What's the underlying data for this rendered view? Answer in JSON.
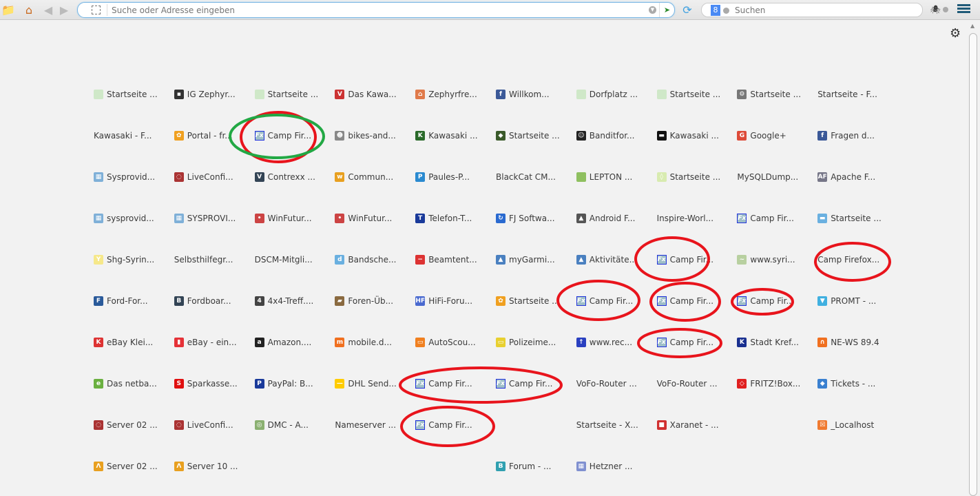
{
  "toolbar": {
    "address_placeholder": "Suche oder Adresse eingeben",
    "search_placeholder": "Suchen",
    "search_engine": "8"
  },
  "colors": {
    "annotation_red": "#e8141c",
    "annotation_green": "#22a844"
  },
  "grid": [
    [
      {
        "t": "Startseite ...",
        "i": "quill"
      },
      {
        "t": "IG Zephyr...",
        "i": "badge"
      },
      {
        "t": "Startseite ...",
        "i": "quill"
      },
      {
        "t": "Das Kawa...",
        "i": "v"
      },
      {
        "t": "Zephyrfre...",
        "i": "house"
      },
      {
        "t": "Willkom...",
        "i": "facebook"
      },
      {
        "t": "Dorfplatz ...",
        "i": "quill"
      },
      {
        "t": "Startseite ...",
        "i": "quill"
      },
      {
        "t": "Startseite ...",
        "i": "gear"
      },
      {
        "t": "Startseite - F...",
        "i": ""
      }
    ],
    [
      {
        "t": "Kawasaki - F...",
        "i": ""
      },
      {
        "t": "Portal - fr...",
        "i": "portal"
      },
      {
        "t": "Camp Fir...",
        "i": "fx"
      },
      {
        "t": "bikes-and...",
        "i": "skull"
      },
      {
        "t": "Kawasaki ...",
        "i": "kawasaki"
      },
      {
        "t": "Startseite ...",
        "i": "shield"
      },
      {
        "t": "Banditfor...",
        "i": "smiley"
      },
      {
        "t": "Kawasaki ...",
        "i": "kw"
      },
      {
        "t": "Google+",
        "i": "gplus"
      },
      {
        "t": "Fragen d...",
        "i": "facebook"
      }
    ],
    [
      {
        "t": "Sysprovid...",
        "i": "sys"
      },
      {
        "t": "LiveConfi...",
        "i": "live"
      },
      {
        "t": "Contrexx ...",
        "i": "contrexx"
      },
      {
        "t": "Commun...",
        "i": "comm"
      },
      {
        "t": "Paules-P...",
        "i": "paules"
      },
      {
        "t": "BlackCat CM...",
        "i": ""
      },
      {
        "t": "LEPTON ...",
        "i": "lepton"
      },
      {
        "t": "Startseite ...",
        "i": "bottle"
      },
      {
        "t": "MySQLDump...",
        "i": ""
      },
      {
        "t": "Apache F...",
        "i": "af"
      }
    ],
    [
      {
        "t": "sysprovid...",
        "i": "sys"
      },
      {
        "t": "SYSPROVI...",
        "i": "sys"
      },
      {
        "t": "WinFutur...",
        "i": "winf"
      },
      {
        "t": "WinFutur...",
        "i": "winf"
      },
      {
        "t": "Telefon-T...",
        "i": "tt"
      },
      {
        "t": "FJ Softwa...",
        "i": "fj"
      },
      {
        "t": "Android F...",
        "i": "android"
      },
      {
        "t": "Inspire-Worl...",
        "i": ""
      },
      {
        "t": "Camp Fir...",
        "i": "fx"
      },
      {
        "t": "Startseite ...",
        "i": "chat"
      }
    ],
    [
      {
        "t": "Shg-Syrin...",
        "i": "shg"
      },
      {
        "t": "Selbsthilfegr...",
        "i": ""
      },
      {
        "t": "DSCM-Mitgli...",
        "i": ""
      },
      {
        "t": "Bandsche...",
        "i": "db"
      },
      {
        "t": "Beamtent...",
        "i": "stop"
      },
      {
        "t": "myGarmi...",
        "i": "garmin"
      },
      {
        "t": "Aktivitäte...",
        "i": "garmin"
      },
      {
        "t": "Camp Fir...",
        "i": "fx"
      },
      {
        "t": "www.syri...",
        "i": "syri"
      },
      {
        "t": "Camp Firefox...",
        "i": ""
      }
    ],
    [
      {
        "t": "Ford-For...",
        "i": "ford"
      },
      {
        "t": "Fordboar...",
        "i": "fordboard"
      },
      {
        "t": "4x4-Treff....",
        "i": "4x4"
      },
      {
        "t": "Foren-Üb...",
        "i": "foren"
      },
      {
        "t": "HiFi-Foru...",
        "i": "hf"
      },
      {
        "t": "Startseite ...",
        "i": "portal"
      },
      {
        "t": "Camp Fir...",
        "i": "fx"
      },
      {
        "t": "Camp Fir...",
        "i": "fx"
      },
      {
        "t": "Camp Fir...",
        "i": "fx"
      },
      {
        "t": "PROMT - ...",
        "i": "promt"
      }
    ],
    [
      {
        "t": "eBay Klei...",
        "i": "k"
      },
      {
        "t": "eBay - ein...",
        "i": "ebay"
      },
      {
        "t": "Amazon....",
        "i": "amazon"
      },
      {
        "t": "mobile.d...",
        "i": "mobile"
      },
      {
        "t": "AutoScou...",
        "i": "auto"
      },
      {
        "t": "Polizeime...",
        "i": "note"
      },
      {
        "t": "www.rec...",
        "i": "fdr"
      },
      {
        "t": "Camp Fir...",
        "i": "fx"
      },
      {
        "t": "Stadt Kref...",
        "i": "kr"
      },
      {
        "t": "NE-WS 89.4",
        "i": "headphones"
      }
    ],
    [
      {
        "t": "Das netba...",
        "i": "netbank"
      },
      {
        "t": "Sparkasse...",
        "i": "sparkasse"
      },
      {
        "t": "PayPal: B...",
        "i": "paypal"
      },
      {
        "t": "DHL Send...",
        "i": "dhl"
      },
      {
        "t": "Camp Fir...",
        "i": "fx"
      },
      {
        "t": "Camp Fir...",
        "i": "fx"
      },
      {
        "t": "VoFo-Router ...",
        "i": ""
      },
      {
        "t": "VoFo-Router ...",
        "i": ""
      },
      {
        "t": "FRITZ!Box...",
        "i": "fritz"
      },
      {
        "t": "Tickets - ...",
        "i": "tickets"
      }
    ],
    [
      {
        "t": "Server 02 ...",
        "i": "live"
      },
      {
        "t": "LiveConfi...",
        "i": "live"
      },
      {
        "t": "DMC - A...",
        "i": "dmc"
      },
      {
        "t": "Nameserver ...",
        "i": ""
      },
      {
        "t": "Camp Fir...",
        "i": "fx"
      },
      null,
      {
        "t": "Startseite - X...",
        "i": ""
      },
      {
        "t": "Xaranet - ...",
        "i": "cube"
      },
      null,
      {
        "t": "_Localhost",
        "i": "xampp"
      }
    ],
    [
      {
        "t": "Server 02 ...",
        "i": "pma"
      },
      {
        "t": "Server 10 ...",
        "i": "pma"
      },
      null,
      null,
      null,
      {
        "t": "Forum - ...",
        "i": "forumb"
      },
      {
        "t": "Hetzner ...",
        "i": "hetzner"
      },
      null,
      null,
      null
    ]
  ]
}
